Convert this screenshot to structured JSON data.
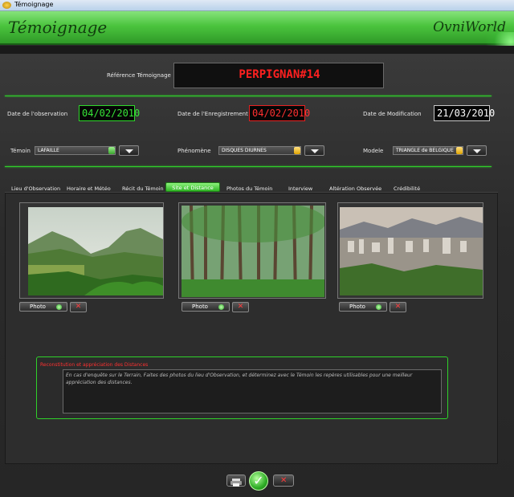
{
  "window": {
    "title": "Témoignage"
  },
  "header": {
    "title": "Témoignage",
    "brand": "OvniWorld"
  },
  "reference": {
    "label": "Référence Témoignage",
    "value": "PERPIGNAN#14"
  },
  "dates": {
    "observation": {
      "label": "Date de l'observation",
      "value": "04/02/2010"
    },
    "enregistrement": {
      "label": "Date de l'Enregistrement",
      "value": "04/02/2010"
    },
    "modification": {
      "label": "Date de Modification",
      "value": "21/03/2010"
    }
  },
  "fields": {
    "temoin": {
      "label": "Témoin",
      "value": "LAFAILLE"
    },
    "phenomene": {
      "label": "Phénomène",
      "value": "DISQUES DIURNES"
    },
    "modele": {
      "label": "Modele",
      "value": "TRIANGLE de BELGIQUE"
    }
  },
  "tabs": [
    {
      "label": "Lieu d'Observation"
    },
    {
      "label": "Horaire et Météo"
    },
    {
      "label": "Récit du Témoin"
    },
    {
      "label": "Site et Distance"
    },
    {
      "label": "Photos du Témoin"
    },
    {
      "label": "Interview"
    },
    {
      "label": "Altération Observée"
    },
    {
      "label": "Crédibilité"
    }
  ],
  "photos": {
    "button_label": "Photo",
    "items": [
      {
        "icon": "landscape-hills-photo"
      },
      {
        "icon": "forest-photo"
      },
      {
        "icon": "city-photo"
      }
    ]
  },
  "reconstitution": {
    "title": "Reconstitution et appréciation des Distances",
    "text": "En cas d'enquête sur le Terrain, Faites des photos du lieu d'Observation, et déterminez avec le Témoin les repères utilisables pour une meilleur appréciation des distances."
  },
  "colors": {
    "accent": "#2fd12a",
    "reference": "#ff2020"
  }
}
